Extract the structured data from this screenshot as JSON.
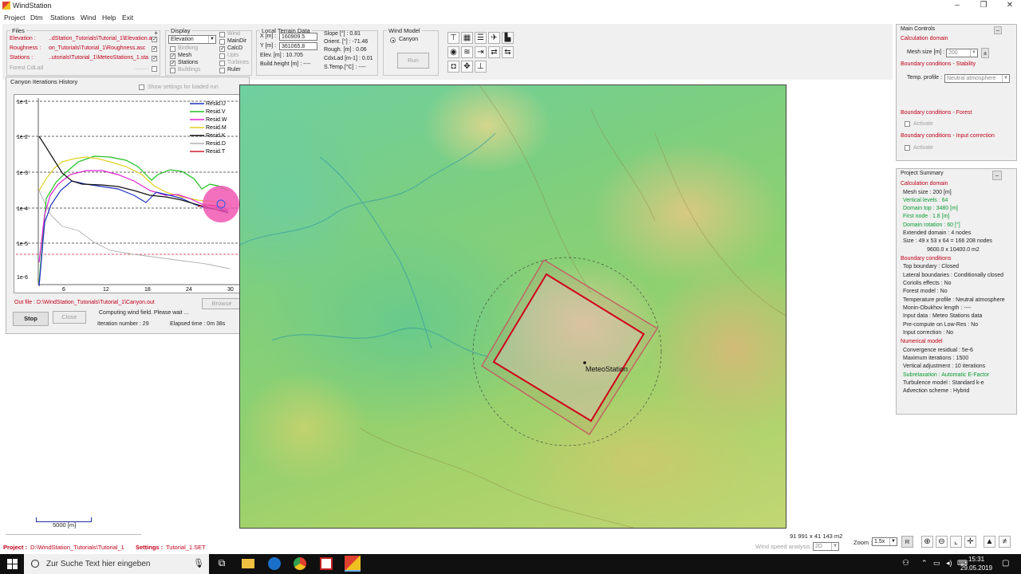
{
  "window": {
    "title": "WindStation",
    "minimize": "–",
    "restore": "❐",
    "close": "✕"
  },
  "menu": [
    "Project",
    "Dtm",
    "Stations",
    "Wind",
    "Help",
    "Exit"
  ],
  "files": {
    "title": "Files",
    "plus": "+",
    "rows": [
      {
        "label": "Elevation :",
        "value": "..dStation_Tutorials\\Tutorial_1\\Elevation.asc",
        "checked": true
      },
      {
        "label": "Roughness :",
        "value": "on_Tutorials\\Tutorial_1\\Roughness.asc",
        "checked": true
      },
      {
        "label": "Stations :",
        "value": "..utorials\\Tutorial_1\\MeteoStations_1.sta",
        "checked": true
      },
      {
        "label": "Forest CdLad",
        "value": ".........",
        "checked": false
      }
    ]
  },
  "display": {
    "title": "Display",
    "select": "Elevation",
    "left": [
      {
        "label": "Birdking",
        "checked": false,
        "disabled": true
      },
      {
        "label": "Mesh",
        "checked": true,
        "disabled": false
      },
      {
        "label": "Stations",
        "checked": true,
        "disabled": false
      },
      {
        "label": "Buildings",
        "checked": false,
        "disabled": true
      }
    ],
    "right": [
      {
        "label": "Wind",
        "checked": false,
        "disabled": true
      },
      {
        "label": "MainDir",
        "checked": false,
        "disabled": false
      },
      {
        "label": "CalcD",
        "checked": true,
        "disabled": false
      },
      {
        "label": "Upts",
        "checked": false,
        "disabled": true
      },
      {
        "label": "Turbines",
        "checked": false,
        "disabled": true
      },
      {
        "label": "Ruler",
        "checked": false,
        "disabled": false
      }
    ]
  },
  "terrain": {
    "title": "Local Terrain Data",
    "x_label": "X [m] :",
    "x_value": "160909.5",
    "y_label": "Y [m] :",
    "y_value": "361065.8",
    "elev": "Elev. [m] : 10.705",
    "build": "Build.height [m] : ----",
    "slope": "Slope [°] : 0.81",
    "orient": "Orient. [°] : -71.46",
    "rough": "Rough. [m] : 0.06",
    "cdx": "CdxLad [m-1] : 0.01",
    "stemp": "S.Temp.[°C] : ----"
  },
  "wind_model": {
    "title": "Wind Model",
    "option": "Canyon",
    "run": "Run"
  },
  "toolbar_icons": [
    "cut-tool-icon",
    "grid-icon",
    "list-icon",
    "turbine-icon",
    "chart-icon",
    "eye-icon",
    "layers-icon",
    "export-icon",
    "link-icon",
    "unlink-icon",
    "camera-icon",
    "move-icon",
    "anchor-icon"
  ],
  "history": {
    "title": "Canyon Iterations History",
    "show_settings": "Show settings for loaded run",
    "y_ticks": [
      "1e-1",
      "1e-2",
      "1e-3",
      "1e-4",
      "1e-5",
      "1e-6"
    ],
    "x_ticks": [
      "6",
      "12",
      "18",
      "24",
      "30"
    ],
    "legend": [
      {
        "name": "Resid.U",
        "color": "#2030c0"
      },
      {
        "name": "Resid.V",
        "color": "#20c020"
      },
      {
        "name": "Resid.W",
        "color": "#e020d0"
      },
      {
        "name": "Resid.M",
        "color": "#e0d020"
      },
      {
        "name": "Resid.K",
        "color": "#101010"
      },
      {
        "name": "Resid.D",
        "color": "#b0b0b0"
      },
      {
        "name": "Resid.T",
        "color": "#d02030"
      }
    ],
    "out_file": "Out file : D:\\WindStation_Tutorials\\Tutorial_1\\Canyon.out",
    "browse": "Browse",
    "stop": "Stop",
    "close": "Close",
    "computing": "Computing wind field. Please wait ...",
    "iteration": "Iteration number : 29",
    "elapsed": "Elapsed time : 0m 38s"
  },
  "main_controls": {
    "title": "Main Controls",
    "calc_domain": "Calculation domain",
    "mesh_label": "Mesh size [m] :",
    "mesh_value": "200",
    "bc_stability": "Boundary conditions - Stability",
    "temp_label": "Temp. profile :",
    "temp_value": "Neutral atmosphere",
    "bc_forest": "Boundary conditions - Forest",
    "activate": "Activate",
    "bc_input": "Boundary conditions - Input correction",
    "activate2": "Activate"
  },
  "summary": {
    "title": "Project Summary",
    "sections": [
      {
        "header": "Calculation domain",
        "lines": [
          {
            "t": "Mesh size : 200 [m]",
            "c": "black"
          },
          {
            "t": "Vertical levels : 64",
            "c": "green"
          },
          {
            "t": "Domain top : 3480 [m]",
            "c": "green"
          },
          {
            "t": "First node : 1.8 [m]",
            "c": "green"
          },
          {
            "t": "Domain rotation : 60 [°]",
            "c": "green"
          },
          {
            "t": "Extended domain : 4 nodes",
            "c": "black"
          },
          {
            "t": "Size : 49 x 53 x 64 = 166 208 nodes",
            "c": "black"
          },
          {
            "t": "9600.0 x 10400.0 m2",
            "c": "black",
            "indent": true
          }
        ]
      },
      {
        "header": "Boundary conditions",
        "lines": [
          {
            "t": "Top boundary : Closed",
            "c": "black"
          },
          {
            "t": "Lateral boundaries : Conditionally closed",
            "c": "black"
          },
          {
            "t": "Coriolis effects : No",
            "c": "black"
          },
          {
            "t": "Forest model : No",
            "c": "black"
          },
          {
            "t": "Temperature profile : Neutral atmosphere",
            "c": "black"
          },
          {
            "t": "Monin-Obukhov length : ----",
            "c": "black"
          },
          {
            "t": "Input data : Meteo Stations data",
            "c": "black"
          },
          {
            "t": "Pre-compute on Low-Res : No",
            "c": "black"
          },
          {
            "t": "Input correction : No",
            "c": "black"
          }
        ]
      },
      {
        "header": "Numerical model",
        "lines": [
          {
            "t": "Convergence residual : 5e-6",
            "c": "black"
          },
          {
            "t": "Maximum iterations : 1500",
            "c": "black"
          },
          {
            "t": "Vertical adjustment : 10 iterations",
            "c": "black"
          },
          {
            "t": "Subrelaxation : Automatic E-Factor",
            "c": "green"
          },
          {
            "t": "Turbulence model : Standard k-e",
            "c": "black"
          },
          {
            "t": "Advection scheme : Hybrid",
            "c": "black"
          }
        ]
      }
    ]
  },
  "map": {
    "station_label": "MeteoStation"
  },
  "scale_bar": "5000 [m]",
  "status": {
    "area": "91 991 x 41 143 m2",
    "wind_speed_label": "Wind speed analysis :",
    "wind_speed_value": "2D",
    "zoom_label": "Zoom :",
    "zoom_value": "1.5x",
    "r_button": "R",
    "project_label": "Project :",
    "project_value": "D:\\WindStation_Tutorials\\Tutorial_1",
    "settings_label": "Settings :",
    "settings_value": "Tutorial_1.SET"
  },
  "taskbar": {
    "search": "Zur Suche Text hier eingeben",
    "time": "15:31",
    "date": "29.05.2019"
  }
}
